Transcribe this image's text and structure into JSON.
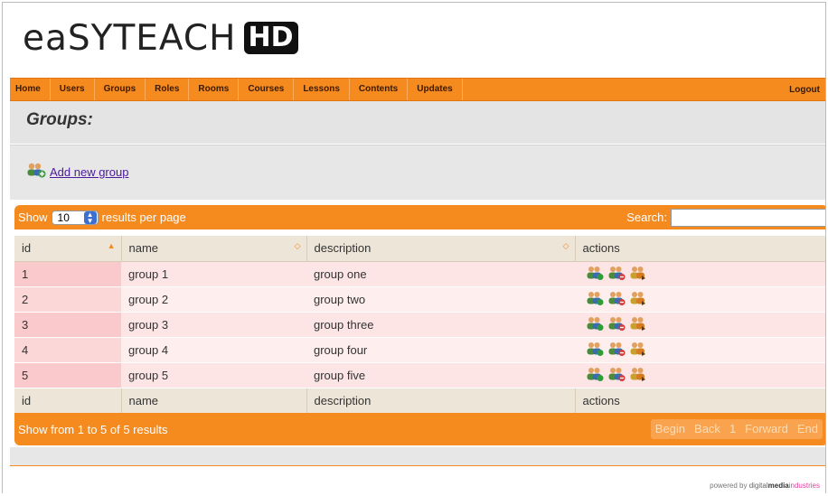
{
  "logo": {
    "word": "eaSYTEACH",
    "badge": "HD"
  },
  "nav": {
    "items": [
      "Home",
      "Users",
      "Groups",
      "Roles",
      "Rooms",
      "Courses",
      "Lessons",
      "Contents",
      "Updates"
    ],
    "logout": "Logout"
  },
  "page": {
    "title": "Groups:",
    "add_link": "Add new group"
  },
  "table": {
    "show_label": "Show",
    "per_page_value": "10",
    "results_per_page_label": "results per page",
    "search_label": "Search:",
    "columns": [
      "id",
      "name",
      "description",
      "actions"
    ],
    "rows": [
      {
        "id": "1",
        "name": "group 1",
        "description": "group one"
      },
      {
        "id": "2",
        "name": "group 2",
        "description": "group two"
      },
      {
        "id": "3",
        "name": "group 3",
        "description": "group three"
      },
      {
        "id": "4",
        "name": "group 4",
        "description": "group four"
      },
      {
        "id": "5",
        "name": "group 5",
        "description": "group five"
      }
    ],
    "result_info": "Show from 1 to 5 of 5 results",
    "pager": [
      "Begin",
      "Back",
      "1",
      "Forward",
      "End"
    ]
  },
  "footer": {
    "powered_by": "powered by",
    "brand_a": "digital",
    "brand_b": "media",
    "brand_c": "industries"
  },
  "colors": {
    "accent": "#f58a1f",
    "row_odd": "#fde5e5",
    "row_even": "#feeeee"
  },
  "icons": {
    "row_actions": [
      "edit-group-icon",
      "delete-group-icon",
      "manage-users-icon"
    ],
    "add": "add-group-icon"
  }
}
